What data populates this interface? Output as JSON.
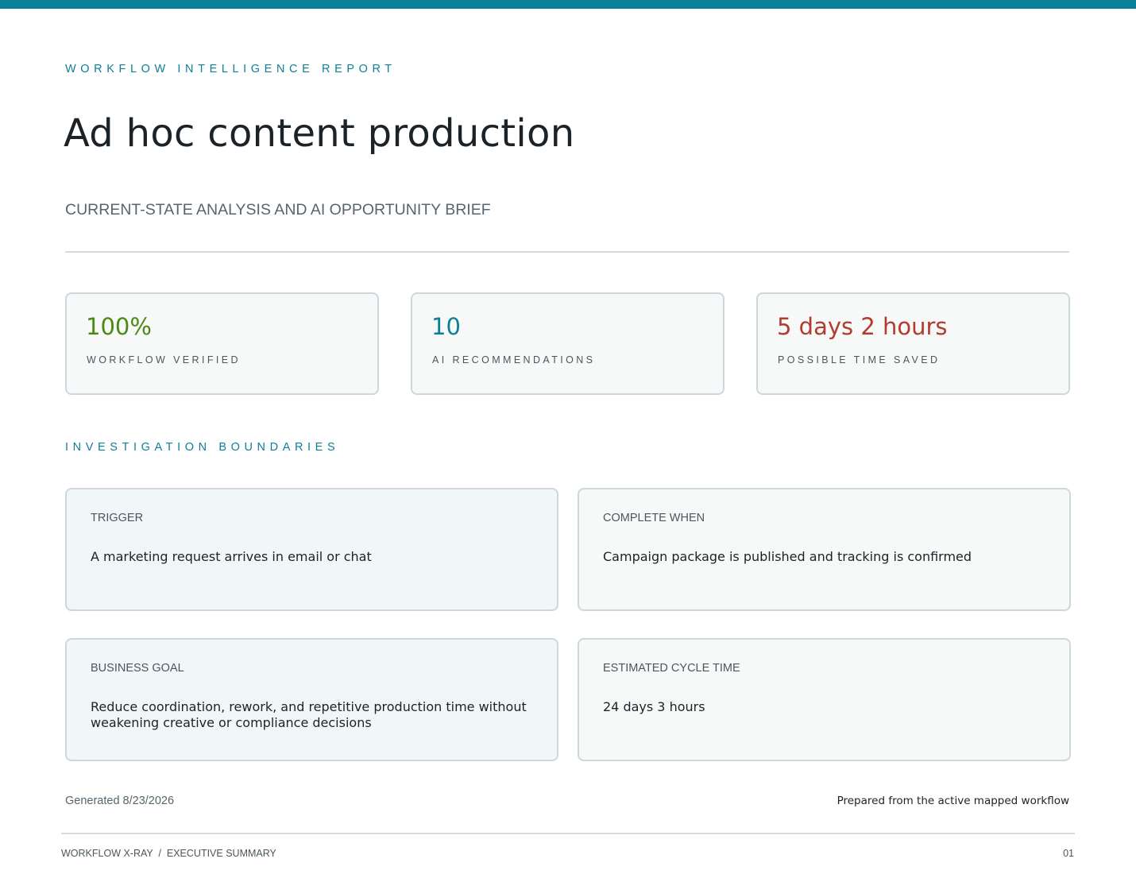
{
  "header": {
    "eyebrow": "WORKFLOW INTELLIGENCE REPORT",
    "title": "Ad hoc content production",
    "subtitle": "CURRENT-STATE ANALYSIS AND AI OPPORTUNITY BRIEF"
  },
  "metrics": [
    {
      "value": "100%",
      "label": "WORKFLOW VERIFIED",
      "color": "#4a8a12"
    },
    {
      "value": "10",
      "label": "AI RECOMMENDATIONS",
      "color": "#0d7f98"
    },
    {
      "value": "5 days 2 hours",
      "label": "POSSIBLE TIME SAVED",
      "color": "#b23b2e"
    }
  ],
  "boundaries": {
    "heading": "INVESTIGATION BOUNDARIES",
    "cards": [
      {
        "label": "TRIGGER",
        "text": "A marketing request arrives in email or chat"
      },
      {
        "label": "COMPLETE WHEN",
        "text": "Campaign package is published and tracking is confirmed"
      },
      {
        "label": "BUSINESS GOAL",
        "text": "Reduce coordination, rework, and repetitive production time without weakening creative or compliance decisions"
      },
      {
        "label": "ESTIMATED CYCLE TIME",
        "text": "24 days 3 hours"
      }
    ]
  },
  "footer": {
    "generated": "Generated 8/23/2026",
    "prepared": "Prepared from the active mapped workflow",
    "breadcrumb": "WORKFLOW X-RAY  /  EXECUTIVE SUMMARY",
    "page_number": "01"
  },
  "colors": {
    "accent": "#0b7f98",
    "verified": "#4a8a12",
    "recommendations": "#0d7f98",
    "time_saved": "#b23b2e"
  }
}
